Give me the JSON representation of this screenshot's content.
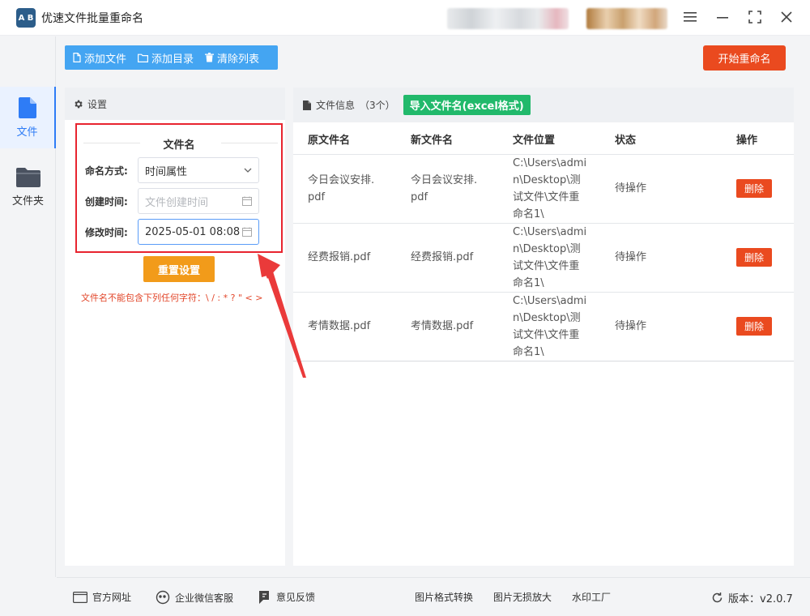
{
  "app": {
    "logo_text": "A B",
    "title": "优速文件批量重命名",
    "window_controls": [
      "menu-icon",
      "minimize-icon",
      "fullscreen-icon",
      "close-icon"
    ]
  },
  "nav": {
    "items": [
      {
        "label": "文件",
        "icon": "file-icon",
        "active": true
      },
      {
        "label": "文件夹",
        "icon": "folder-icon",
        "active": false
      }
    ]
  },
  "toolbar": {
    "add_file": "添加文件",
    "add_dir": "添加目录",
    "clear_list": "清除列表",
    "start_rename": "开始重命名"
  },
  "settings": {
    "header": "设置",
    "section_title": "文件名",
    "naming_label": "命名方式:",
    "naming_value": "时间属性",
    "create_time_label": "创建时间:",
    "create_time_placeholder": "文件创建时间",
    "modify_time_label": "修改时间:",
    "modify_time_value": "2025-05-01 08:08",
    "reset_button": "重置设置",
    "warning": "文件名不能包含下列任何字符：\\ / : * ? \" < >"
  },
  "files": {
    "header_label": "文件信息",
    "count": "（3个）",
    "import_button": "导入文件名(excel格式)",
    "columns": [
      "原文件名",
      "新文件名",
      "文件位置",
      "状态",
      "操作"
    ],
    "rows": [
      {
        "original": "今日会议安排.\npdf",
        "new": "今日会议安排.\npdf",
        "location": "C:\\Users\\admi\nn\\Desktop\\测\n试文件\\文件重\n命名1\\",
        "status": "待操作",
        "action": "删除"
      },
      {
        "original": "经费报销.pdf",
        "new": "经费报销.pdf",
        "location": "C:\\Users\\admi\nn\\Desktop\\测\n试文件\\文件重\n命名1\\",
        "status": "待操作",
        "action": "删除"
      },
      {
        "original": "考情数据.pdf",
        "new": "考情数据.pdf",
        "location": "C:\\Users\\admi\nn\\Desktop\\测\n试文件\\文件重\n命名1\\",
        "status": "待操作",
        "action": "删除"
      }
    ]
  },
  "footer": {
    "website": "官方网址",
    "wechat": "企业微信客服",
    "feedback": "意见反馈",
    "img_convert": "图片格式转换",
    "img_enlarge": "图片无损放大",
    "watermark": "水印工厂",
    "version": "版本：v2.0.7"
  },
  "colors": {
    "toolbar_blue": "#44a5f2",
    "start_red": "#ea4a1f",
    "import_green": "#21b96b",
    "reset_orange": "#f29b1a",
    "highlight_red": "#e8242f",
    "active_blue": "#2e7cf6"
  }
}
